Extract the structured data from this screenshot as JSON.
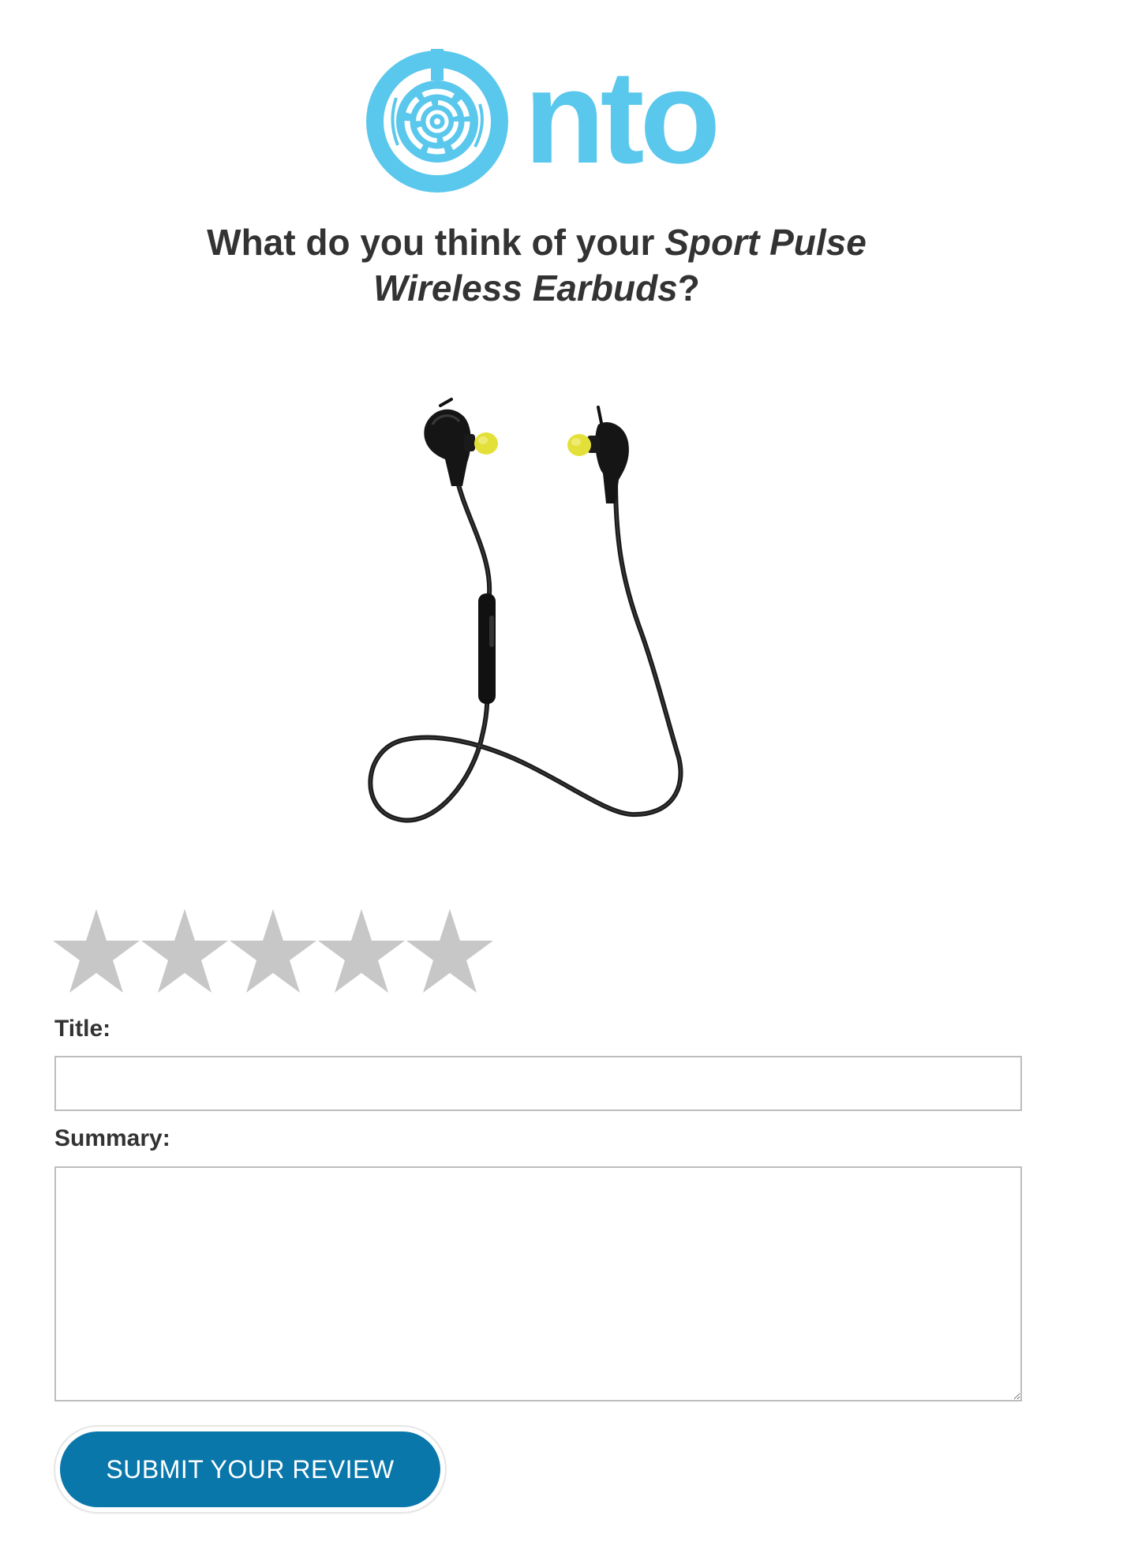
{
  "logo": {
    "wordmark": "nto",
    "icon": "nto-circle-logo-icon",
    "color": "#5ac7ec"
  },
  "heading": {
    "prefix": "What do you think of your ",
    "product_name": "Sport Pulse Wireless Earbuds",
    "suffix": "?"
  },
  "product_image": {
    "icon": "wireless-earbuds-image",
    "accent_color": "#e4e03a"
  },
  "rating": {
    "max": 5,
    "value": 0,
    "star_empty_color": "#c7c7c7",
    "star_icon": "star-icon"
  },
  "form": {
    "title_label": "Title:",
    "title_value": "",
    "summary_label": "Summary:",
    "summary_value": "",
    "submit_label": "SUBMIT YOUR REVIEW",
    "submit_color": "#0a77ab"
  }
}
